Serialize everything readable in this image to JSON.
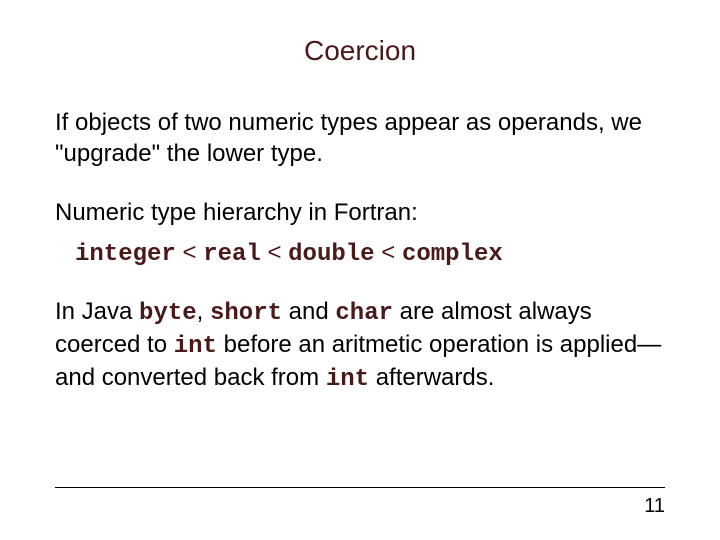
{
  "title": "Coercion",
  "para1": "If objects of two numeric types appear as operands, we \"upgrade\" the lower type.",
  "para2": "Numeric type hierarchy in Fortran:",
  "hierarchy": {
    "t1": "integer",
    "t2": "real",
    "t3": "double",
    "t4": "complex",
    "lt": " < "
  },
  "para3": {
    "pre": "In Java ",
    "byte": "byte",
    "comma": ", ",
    "short": "short",
    "and1": " and ",
    "char": "char",
    "mid1": " are almost always coerced to ",
    "int1": "int",
    "mid2": " before an aritmetic operation is applied—and converted back from ",
    "int2": "int",
    "end": " afterwards."
  },
  "pageNum": "11"
}
